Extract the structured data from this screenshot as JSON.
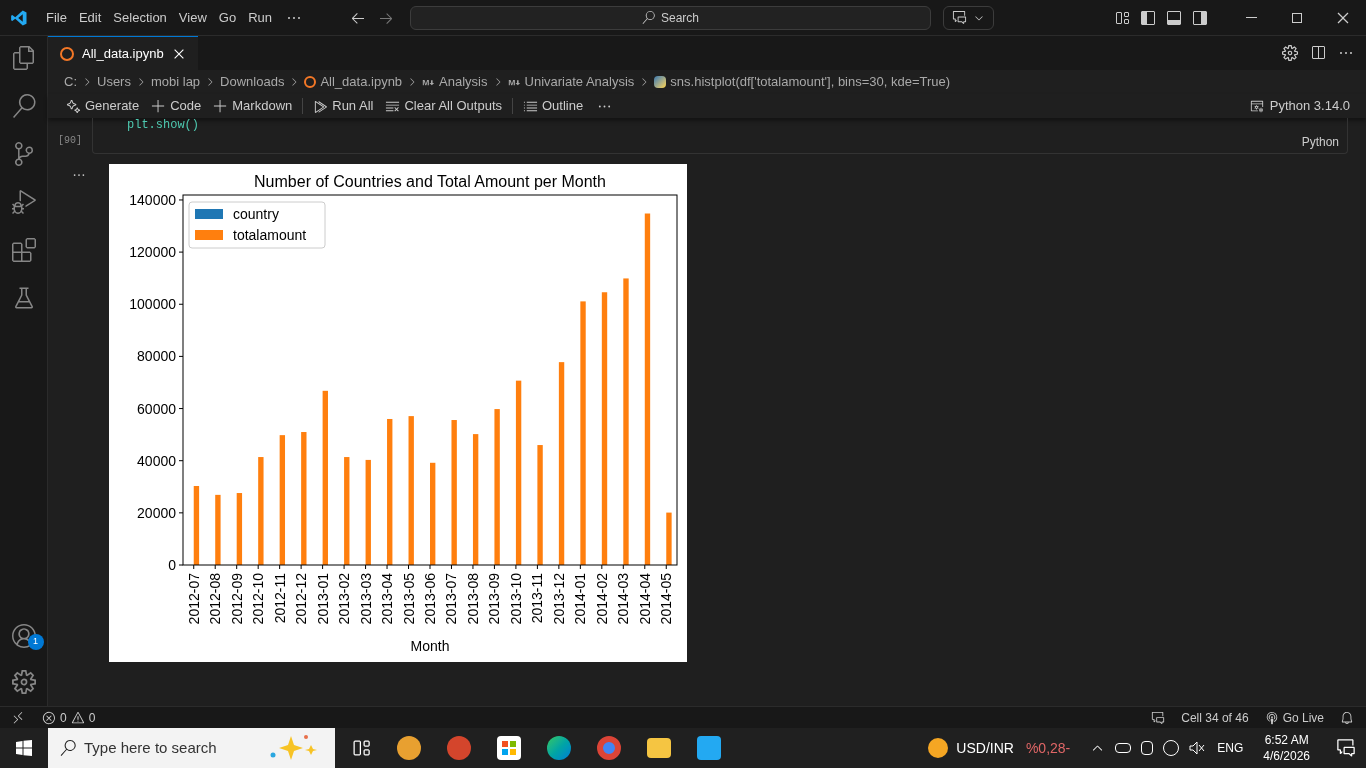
{
  "menu": [
    "File",
    "Edit",
    "Selection",
    "View",
    "Go",
    "Run"
  ],
  "search": {
    "placeholder": "Search"
  },
  "tabs": [
    {
      "label": "All_data.ipynb",
      "selected": true
    }
  ],
  "breadcrumbs": [
    {
      "label": "C:",
      "kind": "plain"
    },
    {
      "label": "Users",
      "kind": "plain"
    },
    {
      "label": "mobi lap",
      "kind": "plain"
    },
    {
      "label": "Downloads",
      "kind": "plain"
    },
    {
      "label": "All_data.ipynb",
      "kind": "notebook"
    },
    {
      "label": "Analysis",
      "kind": "markdown"
    },
    {
      "label": "Univariate Analysis",
      "kind": "markdown"
    },
    {
      "label": "sns.histplot(df['totalamount'], bins=30, kde=True)",
      "kind": "python"
    }
  ],
  "toolbar": [
    {
      "label": "Generate",
      "kind": "sparkle"
    },
    {
      "label": "Code",
      "kind": "add"
    },
    {
      "label": "Markdown",
      "kind": "add"
    },
    {
      "label": "Run All",
      "kind": "run"
    },
    {
      "label": "Clear All Outputs",
      "kind": "clear"
    },
    {
      "label": "Outline",
      "kind": "list"
    }
  ],
  "kernel": "Python 3.14.0",
  "account_badge": "1",
  "cell": {
    "code": "plt.show()",
    "count": "[90]",
    "language": "Python"
  },
  "chart_data": {
    "type": "bar",
    "title": "Number of Countries and Total Amount per Month",
    "xlabel": "Month",
    "categories": [
      "2012-07",
      "2012-08",
      "2012-09",
      "2012-10",
      "2012-11",
      "2012-12",
      "2013-01",
      "2013-02",
      "2013-03",
      "2013-04",
      "2013-05",
      "2013-06",
      "2013-07",
      "2013-08",
      "2013-09",
      "2013-10",
      "2013-11",
      "2013-12",
      "2014-01",
      "2014-02",
      "2014-03",
      "2014-04",
      "2014-05"
    ],
    "series": [
      {
        "name": "country",
        "color": "#1f77b4",
        "values": [
          null,
          null,
          null,
          null,
          null,
          null,
          null,
          null,
          null,
          null,
          null,
          null,
          null,
          null,
          null,
          null,
          null,
          null,
          null,
          null,
          null,
          null,
          null
        ]
      },
      {
        "name": "totalamount",
        "color": "#ff7f0e",
        "values": [
          30300,
          26900,
          27600,
          41400,
          49800,
          51000,
          66800,
          41400,
          40300,
          56000,
          57100,
          39200,
          55600,
          50200,
          59800,
          70700,
          46000,
          77800,
          101100,
          104600,
          109900,
          134800,
          20100
        ]
      }
    ],
    "ylim": [
      0,
      141900
    ],
    "yticks": [
      0,
      20000,
      40000,
      60000,
      80000,
      100000,
      120000,
      140000
    ]
  },
  "status_bar": {
    "errors": "0",
    "warnings": "0",
    "cell": "Cell 34 of 46",
    "live": "Go Live"
  },
  "taskbar": {
    "search": {
      "placeholder": "Type here to search"
    },
    "widget": {
      "label": "USD/INR",
      "change": "%0,28-"
    },
    "language": "ENG",
    "time": "6:52 AM",
    "date": "4/6/2026"
  }
}
